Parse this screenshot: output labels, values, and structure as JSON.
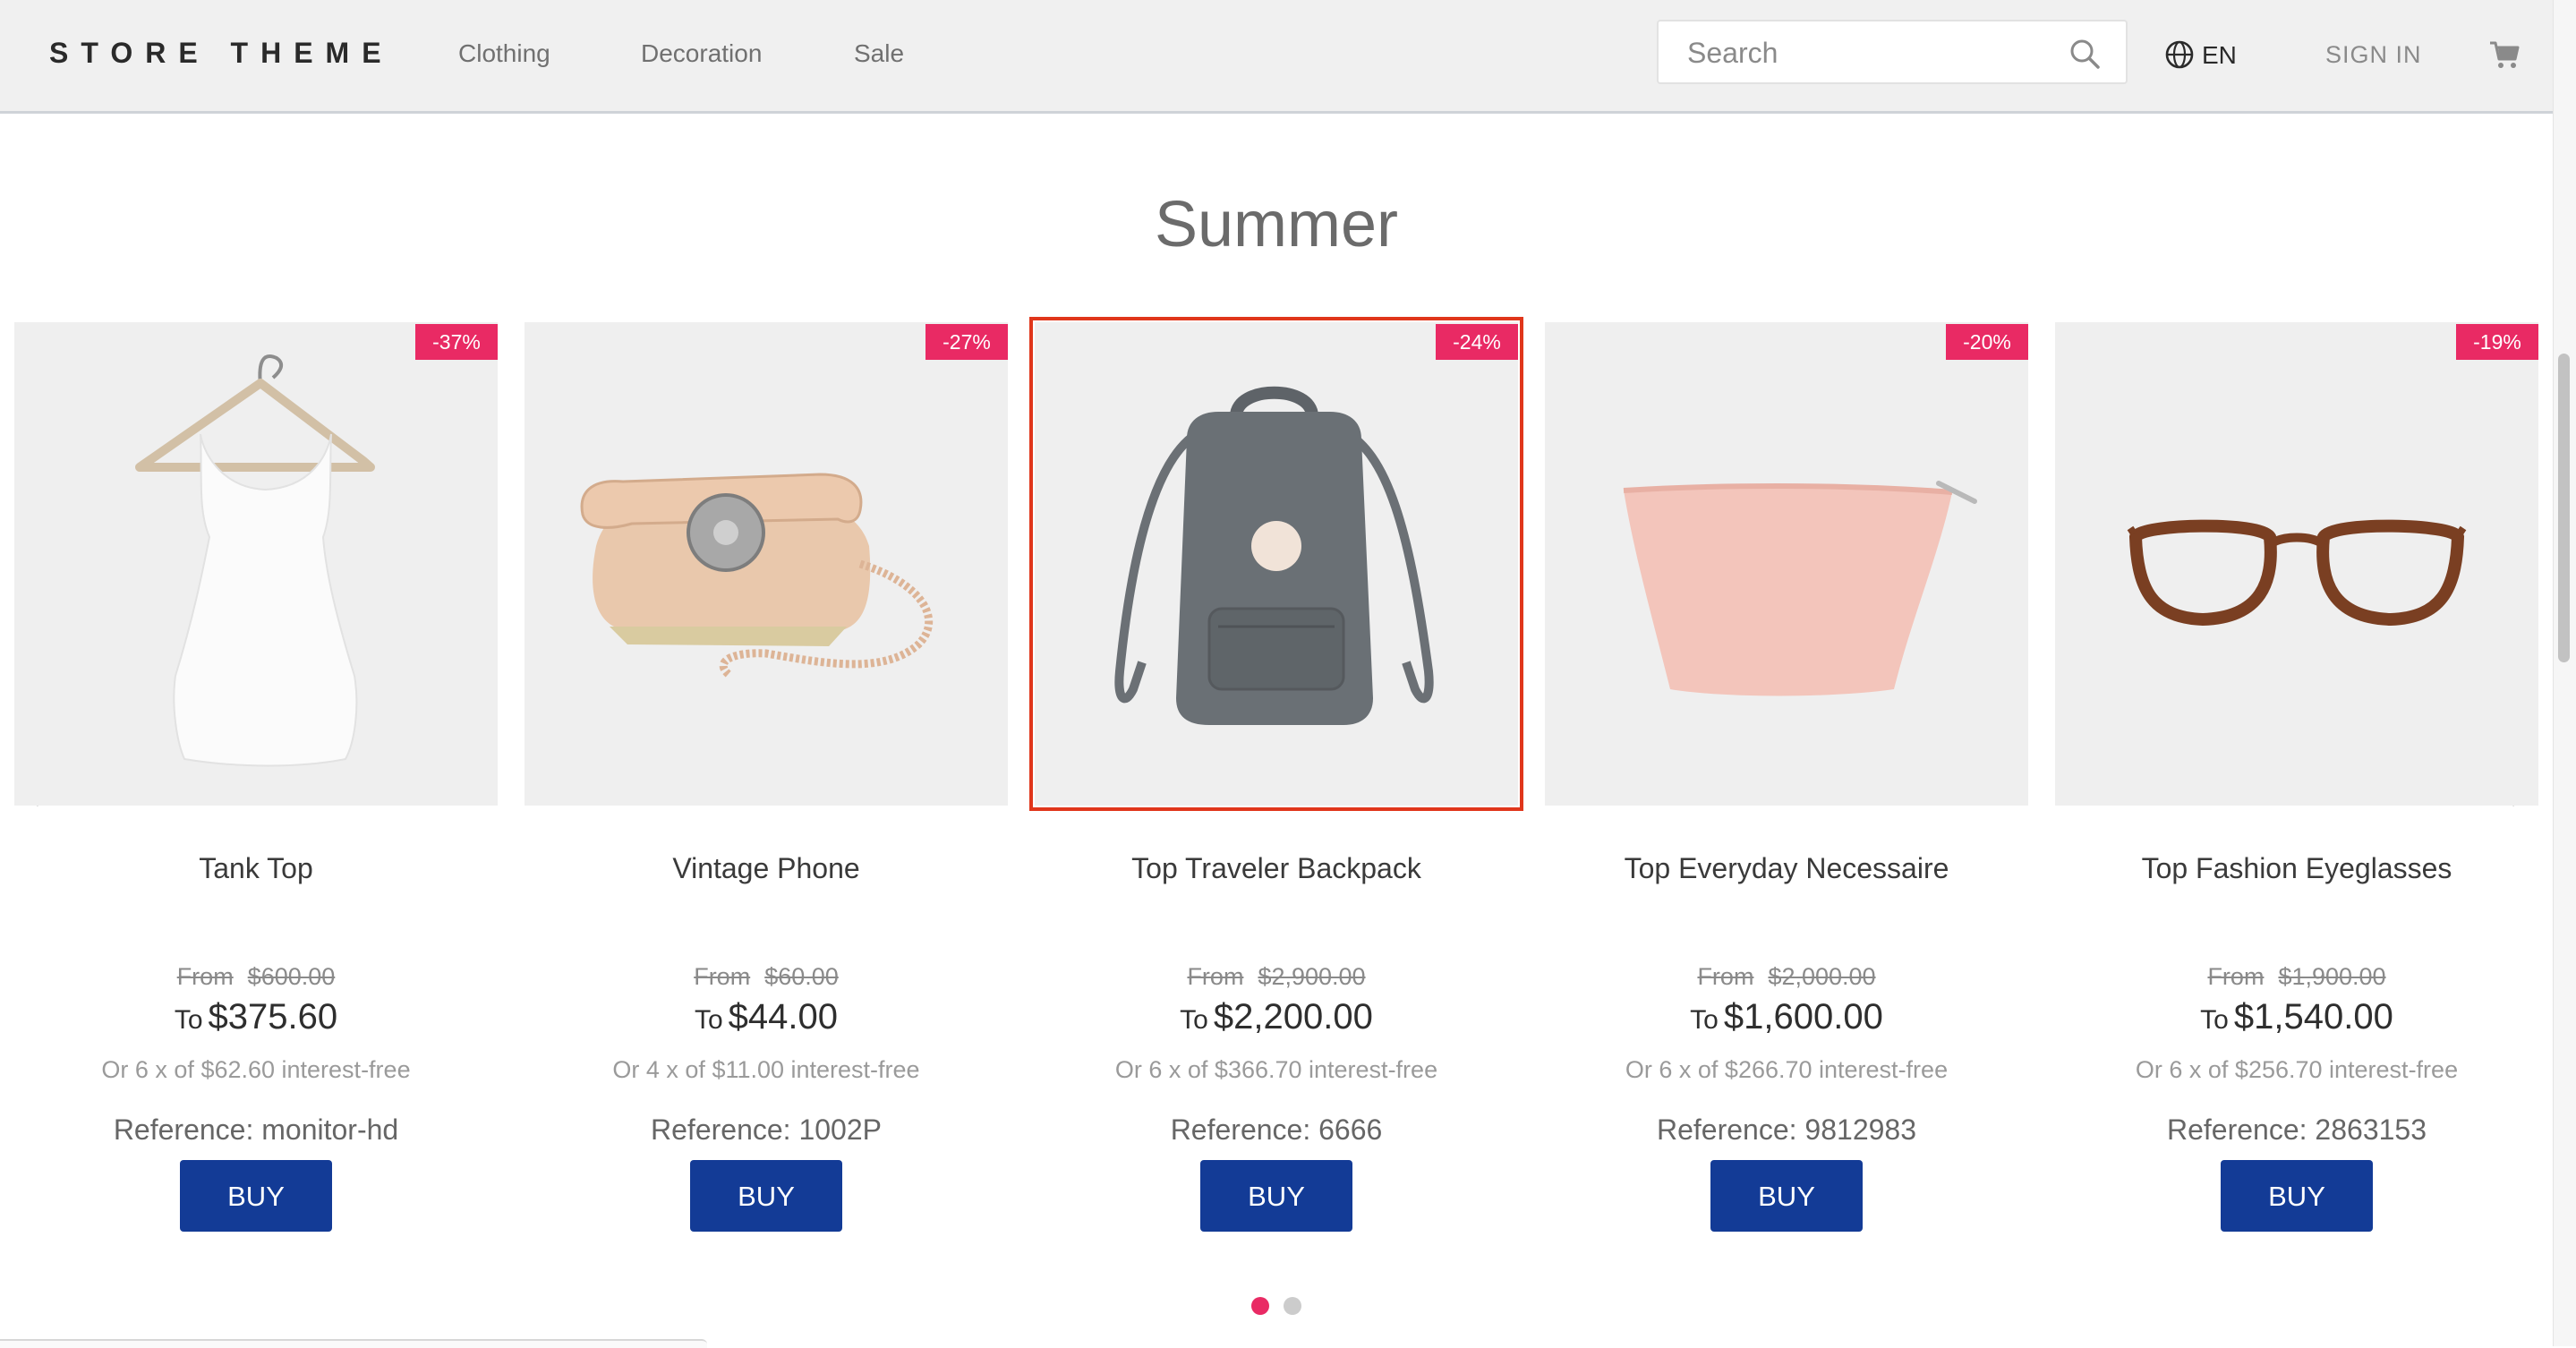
{
  "header": {
    "brand": "STORE THEME",
    "nav": [
      "Clothing",
      "Decoration",
      "Sale"
    ],
    "search_placeholder": "Search",
    "language": "EN",
    "sign_in": "SIGN IN"
  },
  "shelf": {
    "title": "Summer",
    "selected_index": 2,
    "products": [
      {
        "name": "Tank Top",
        "discount": "-37%",
        "from_label": "From",
        "list_price": "$600.00",
        "to_label": "To",
        "price": "$375.60",
        "installments": "Or 6 x of $62.60 interest-free",
        "reference": "Reference: monitor-hd",
        "buy": "BUY"
      },
      {
        "name": "Vintage Phone",
        "discount": "-27%",
        "from_label": "From",
        "list_price": "$60.00",
        "to_label": "To",
        "price": "$44.00",
        "installments": "Or 4 x of $11.00 interest-free",
        "reference": "Reference: 1002P",
        "buy": "BUY"
      },
      {
        "name": "Top Traveler Backpack",
        "discount": "-24%",
        "from_label": "From",
        "list_price": "$2,900.00",
        "to_label": "To",
        "price": "$2,200.00",
        "installments": "Or 6 x of $366.70 interest-free",
        "reference": "Reference: 6666",
        "buy": "BUY"
      },
      {
        "name": "Top Everyday Necessaire",
        "discount": "-20%",
        "from_label": "From",
        "list_price": "$2,000.00",
        "to_label": "To",
        "price": "$1,600.00",
        "installments": "Or 6 x of $266.70 interest-free",
        "reference": "Reference: 9812983",
        "buy": "BUY"
      },
      {
        "name": "Top Fashion Eyeglasses",
        "discount": "-19%",
        "from_label": "From",
        "list_price": "$1,900.00",
        "to_label": "To",
        "price": "$1,540.00",
        "installments": "Or 6 x of $256.70 interest-free",
        "reference": "Reference: 2863153",
        "buy": "BUY"
      }
    ],
    "pagination": {
      "pages": 2,
      "active": 1
    }
  },
  "colors": {
    "badge": "#e92a64",
    "buy_button": "#133b96",
    "selected_outline": "#e0361b",
    "dot_active": "#e92a64",
    "dot_inactive": "#cccccc"
  }
}
